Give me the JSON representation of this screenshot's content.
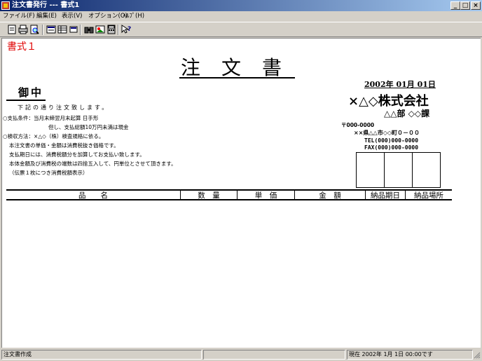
{
  "window": {
    "title": "注文書発行 --- 書式1"
  },
  "menu": {
    "file": "ファイル(F)",
    "edit": "編集(E)",
    "view": "表示(V)",
    "options": "オプション(O)",
    "help": "ﾍﾙﾌﾟ(H)"
  },
  "document": {
    "form_label": "書式１",
    "title": "注文書",
    "date": "2002年 01月 01日",
    "recipient": "御中",
    "greeting": "下記の通り注文致します。",
    "company": "×△◇株式会社",
    "department": "△△部 ◇◇課",
    "postal": "〒000-0000",
    "address": "××県△△市◇◇町０－００",
    "tel": "TEL(000)000-0000",
    "fax": "FAX(000)000-0000",
    "notes": [
      "○支払条件：当月末締翌月末起算 日手形",
      "但し、支払総額10万円未満は現金",
      "○検収方法：×△◇（株）検査規格に依る。",
      "本注文書の単価・金額は消費税抜き価格です。",
      "支払期日には、消費税額分を加算してお支払い致します。",
      "本体金額及び消費税の端数は四捨五入して、円単位とさせて頂きます。",
      "（伝票１枚につき消費税額表示）"
    ],
    "table_headers": [
      "品　　名",
      "数　量",
      "単　価",
      "金　額",
      "納品期日",
      "納品場所"
    ]
  },
  "status": {
    "left": "注文書作成",
    "right": "現在 2002年  1月  1日 00:00です"
  }
}
